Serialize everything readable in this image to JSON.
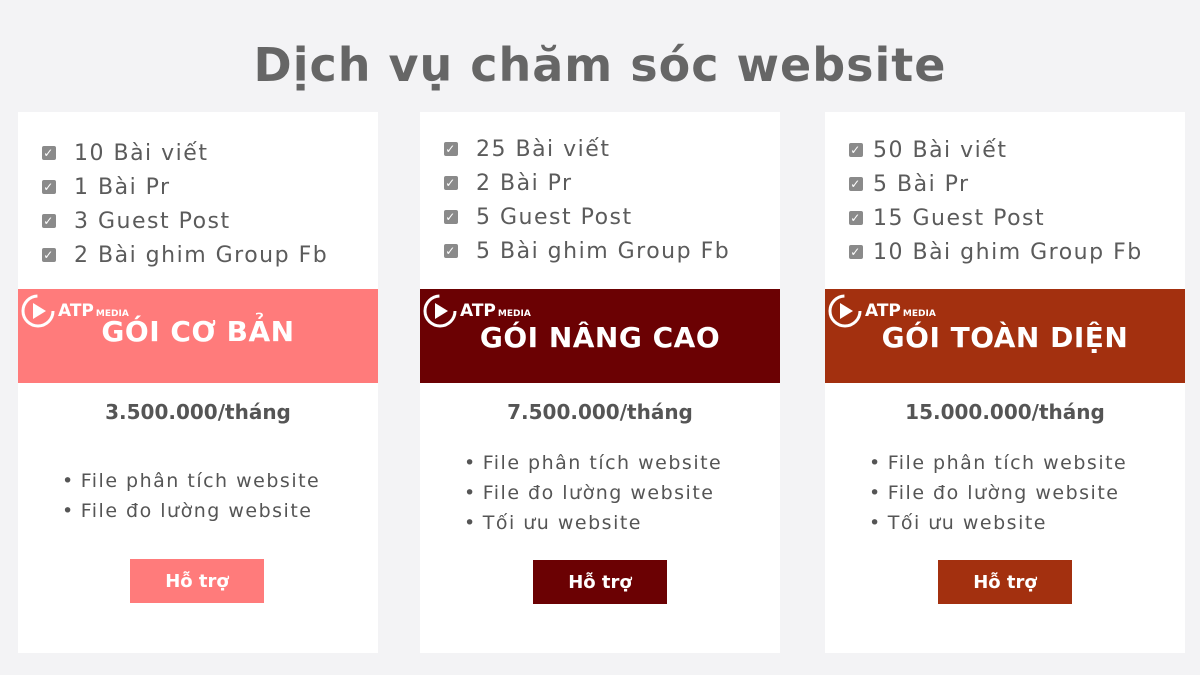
{
  "page": {
    "title": "Dịch vụ chăm sóc website"
  },
  "logo": {
    "brand": "ATP",
    "sub": "MEDIA"
  },
  "plans": [
    {
      "features": [
        "10 Bài viết",
        "1 Bài Pr",
        "3 Guest Post",
        "2 Bài ghim Group Fb"
      ],
      "name": "GÓI CƠ BẢN",
      "price": "3.500.000/tháng",
      "extras": [
        "File phân tích website",
        "File đo lường website"
      ],
      "button": "Hỗ trợ",
      "color": "#ff7b7b"
    },
    {
      "features": [
        "25 Bài viết",
        "2 Bài Pr",
        "5 Guest Post",
        "5 Bài ghim Group Fb"
      ],
      "name": "GÓI NÂNG CAO",
      "price": "7.500.000/tháng",
      "extras": [
        "File phân tích website",
        "File đo lường website",
        "Tối ưu website"
      ],
      "button": "Hỗ trợ",
      "color": "#6b0103"
    },
    {
      "features": [
        "50 Bài viết",
        "5 Bài Pr",
        "15 Guest Post",
        "10 Bài ghim Group Fb"
      ],
      "name": "GÓI TOÀN DIỆN",
      "price": "15.000.000/tháng",
      "extras": [
        "File phân tích website",
        "File đo lường website",
        "Tối ưu website"
      ],
      "button": "Hỗ trợ",
      "color": "#a3300f"
    }
  ]
}
